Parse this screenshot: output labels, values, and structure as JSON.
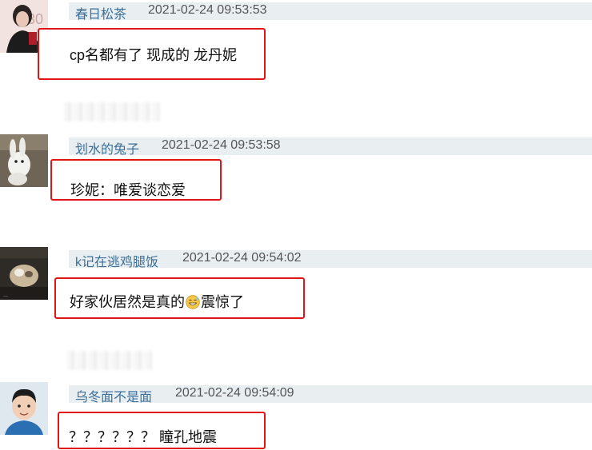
{
  "comments": [
    {
      "username": "春日松茶",
      "timestamp": "2021-02-24 09:53:53",
      "text": "cp名都有了 现成的 龙丹妮"
    },
    {
      "username": "划水的兔子",
      "timestamp": "2021-02-24 09:53:58",
      "text": "珍妮：唯爱谈恋爱"
    },
    {
      "username": "k记在逃鸡腿饭",
      "timestamp": "2021-02-24 09:54:02",
      "text_before": "好家伙居然是真的",
      "emoji": "grinning-sweat-icon",
      "text_after": "震惊了"
    },
    {
      "username": "乌冬面不是面",
      "timestamp": "2021-02-24 09:54:09",
      "text": "？？？？？？ 瞳孔地震"
    }
  ],
  "colors": {
    "highlight_border": "#e01616",
    "header_bg": "#e9eef1",
    "username": "#3b6f9a"
  }
}
